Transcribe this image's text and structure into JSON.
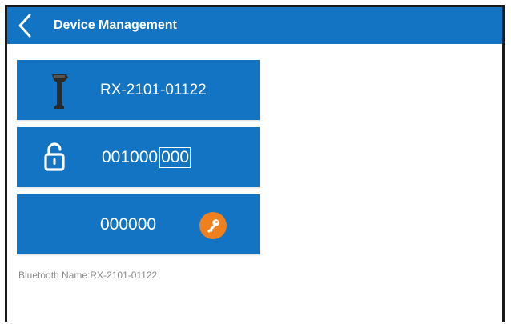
{
  "header": {
    "title": "Device Management",
    "back_icon": "chevron-left-icon",
    "color": "#1274c2"
  },
  "device": {
    "id": "RX-2101-01122",
    "icon": "barcode-scanner-icon"
  },
  "code": {
    "prefix": "001000",
    "suffix": "000",
    "icon": "unlock-icon"
  },
  "pin": {
    "value": "000000",
    "icon": "key-icon",
    "badge_color": "#f0801e"
  },
  "bluetooth": {
    "label": "Bluetooth Name:RX-2101-01122"
  }
}
